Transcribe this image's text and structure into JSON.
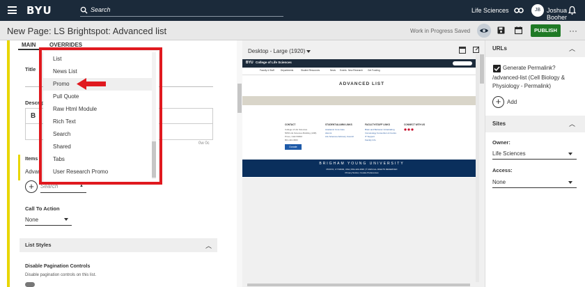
{
  "topnav": {
    "logo": "BYU",
    "search_placeholder": "Search",
    "site_name": "Life Sciences",
    "user_initials": "JB",
    "user_name": "Joshua Booher"
  },
  "titlebar": {
    "title": "New Page: LS Brightspot: Advanced list",
    "status": "Work in Progress Saved",
    "publish_label": "PUBLISH",
    "more_label": "···"
  },
  "left": {
    "tabs": [
      "MAIN",
      "OVERRIDES"
    ],
    "title_label": "Title",
    "description_label": "Descrip",
    "rte_bold": "B",
    "char_count": "0w 0c",
    "items_label": "Items",
    "items_value": "Advan",
    "search_placeholder": "Search",
    "cta_label": "Call To Action",
    "cta_value": "None",
    "list_styles_label": "List Styles",
    "dpc_label": "Disable Pagination Controls",
    "dpc_desc": "Disable pagination controls on this list."
  },
  "dropdown": {
    "items": [
      "List",
      "News List",
      "Promo",
      "Pull Quote",
      "Raw Html Module",
      "Rich Text",
      "Search",
      "Shared",
      "Tabs",
      "User Research Promo"
    ],
    "highlighted": "Promo"
  },
  "preview": {
    "device": "Desktop - Large (1920)",
    "logo": "BYU",
    "college": "College of Life Sciences",
    "subnav": [
      "Faculty & Staff",
      "Departments",
      "Student Resources",
      "News",
      "Events",
      "New Research",
      "Get Funding"
    ],
    "heading": "ADVANCED LIST",
    "footer_cols": [
      {
        "title": "CONTACT",
        "lines": [
          "College of Life Sciences",
          "5050 Life Sciences Building (LSB)",
          "Provo, Utah 84602",
          "801-422-3963"
        ],
        "link_color": "#555"
      },
      {
        "title": "STUDENT/ALUMNI LINKS",
        "lines": [
          "Academic Core Care",
          "Alumni",
          "Life Sciences Advisory Council"
        ],
        "link_color": "#2a5ca3"
      },
      {
        "title": "FACULTY/STAFF LINKS",
        "lines": [
          "Brain and Behavior Undertaking",
          "Immunology Consortium & Centre",
          "IT Support",
          "Faculty Info"
        ],
        "link_color": "#2a5ca3"
      },
      {
        "title": "CONNECT WITH US",
        "lines": [],
        "link_color": "#555"
      }
    ],
    "donate": "Donate",
    "byu_title": "BRIGHAM YOUNG UNIVERSITY",
    "byu_sub": "PROVO, UT 84602, USA | 801-422-4636 | © 2023 ALL RIGHTS RESERVED",
    "byu_sub2": "Privacy Notice | Cookie Preferences"
  },
  "right": {
    "urls_label": "URLs",
    "generate_permalink": "Generate Permalink?",
    "permalink_value": "/advanced-list (Cell Biology & Physiology - Permalink)",
    "add_label": "Add",
    "sites_label": "Sites",
    "owner_label": "Owner:",
    "owner_value": "Life Sciences",
    "access_label": "Access:",
    "access_value": "None"
  },
  "colors": {
    "nav_bg": "#1b2a3a",
    "publish_green": "#1f7a25",
    "highlight_red": "#e0191f",
    "yellow_rail": "#e8d600",
    "byu_blue": "#0a2f5c"
  }
}
